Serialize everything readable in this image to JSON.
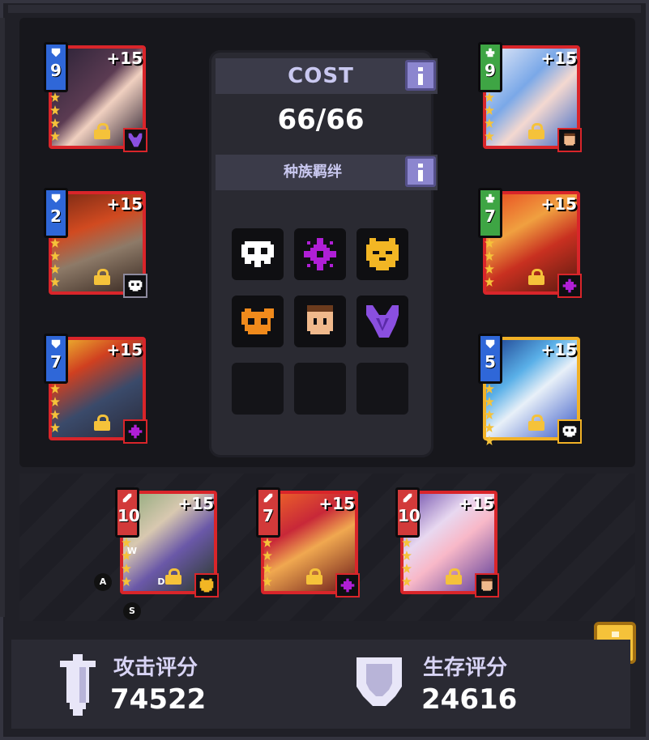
{
  "cost": {
    "title": "COST",
    "value": "66/66",
    "info_icon": "info-icon"
  },
  "bond": {
    "title": "种族羁绊",
    "info_icon": "info-icon"
  },
  "race_icons": [
    {
      "name": "skull-race-icon",
      "color": "#ffffff"
    },
    {
      "name": "spore-race-icon",
      "color": "#b01fd6"
    },
    {
      "name": "cat-race-icon",
      "color": "#f2b624"
    },
    {
      "name": "beast-race-icon",
      "color": "#f08a1c"
    },
    {
      "name": "human-race-icon",
      "color": "#f0b98c"
    },
    {
      "name": "demon-race-icon",
      "color": "#8a4fe0"
    }
  ],
  "heroes": [
    {
      "id": "h1",
      "level": "9",
      "class": "blue",
      "plus": "+15",
      "stars": 4,
      "frame": "red",
      "race": "demon-race-icon"
    },
    {
      "id": "h2",
      "level": "2",
      "class": "blue",
      "plus": "+15",
      "stars": 4,
      "frame": "gray",
      "race": "skull-race-icon"
    },
    {
      "id": "h3",
      "level": "7",
      "class": "blue",
      "plus": "+15",
      "stars": 4,
      "frame": "red",
      "race": "spore-race-icon"
    },
    {
      "id": "h4",
      "level": "9",
      "class": "green",
      "plus": "+15",
      "stars": 4,
      "frame": "red",
      "race": "human-race-icon"
    },
    {
      "id": "h5",
      "level": "7",
      "class": "green",
      "plus": "+15",
      "stars": 4,
      "frame": "red",
      "race": "spore-race-icon"
    },
    {
      "id": "h6",
      "level": "5",
      "class": "blue",
      "plus": "+15",
      "stars": 5,
      "frame": "gold",
      "race": "skull-race-icon"
    },
    {
      "id": "h7",
      "level": "10",
      "class": "red",
      "plus": "+15",
      "stars": 4,
      "frame": "red",
      "race": "cat-race-icon"
    },
    {
      "id": "h8",
      "level": "7",
      "class": "red",
      "plus": "+15",
      "stars": 4,
      "frame": "red",
      "race": "spore-race-icon"
    },
    {
      "id": "h9",
      "level": "10",
      "class": "red",
      "plus": "+15",
      "stars": 4,
      "frame": "red",
      "race": "human-race-icon"
    }
  ],
  "keys": {
    "w": "W",
    "a": "A",
    "s": "S",
    "d": "D"
  },
  "stats": {
    "attack_label": "攻击评分",
    "attack_value": "74522",
    "survival_label": "生存评分",
    "survival_value": "24616"
  },
  "colors": {
    "frame_red": "#d9252a",
    "frame_gold": "#f1b126",
    "frame_gray": "#8d8a9e",
    "accent_purple": "#8c86cf"
  }
}
